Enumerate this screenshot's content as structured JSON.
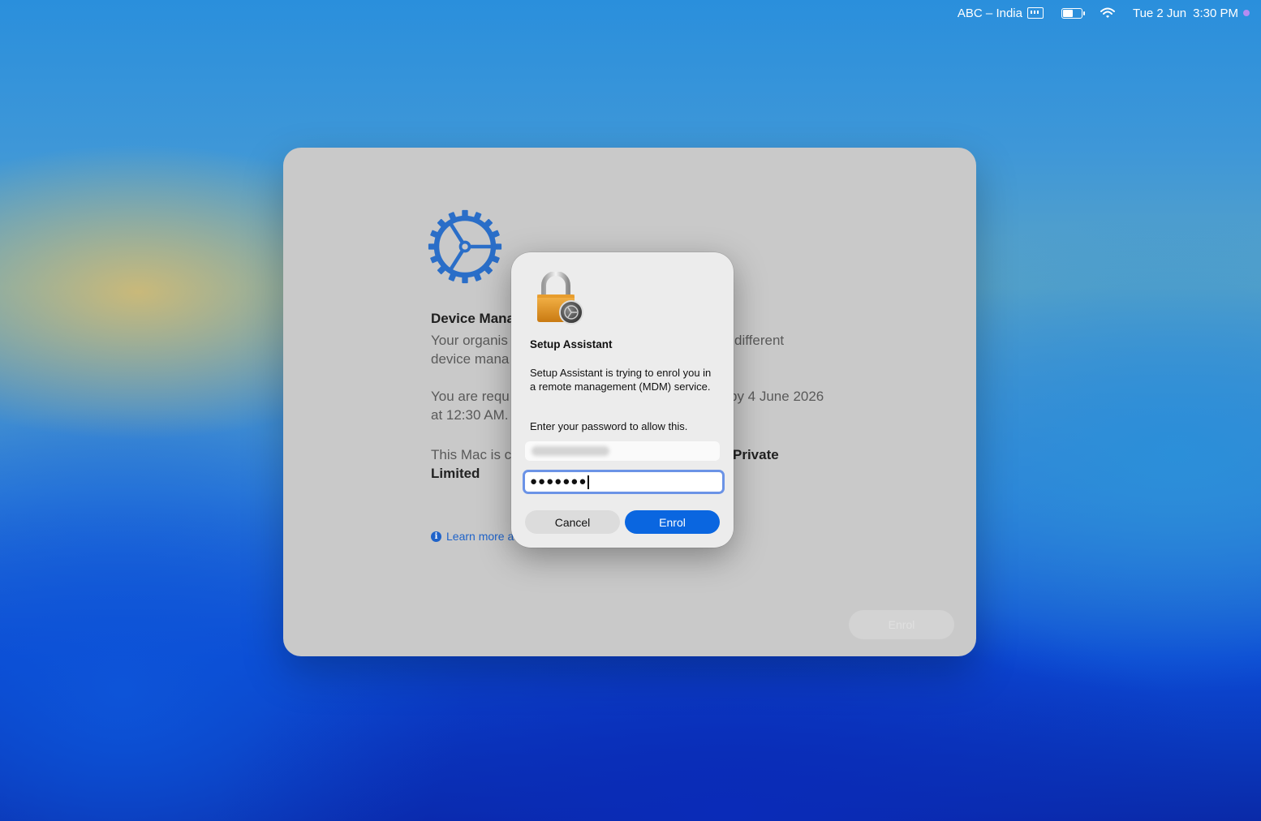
{
  "menubar": {
    "input_source": "ABC – India",
    "date": "Tue 2 Jun",
    "time": "3:30 PM",
    "icons": [
      "keyboard-icon",
      "battery-icon",
      "wifi-icon",
      "siri-dot-icon"
    ]
  },
  "window": {
    "title_partial": "Device Mana",
    "para1_line1_partial": "Your organis",
    "para1_line2_partial": "device mana",
    "para1_right_partial": "different",
    "para2_line1_partial": "You are requ",
    "para2_line2_partial": "at 12:30 AM.",
    "para2_right_partial": "by 4 June 2026",
    "para3_line1_partial": "This Mac is c",
    "para3_line2": "Limited",
    "para3_right_partial": "Private",
    "learn_more_partial": "Learn more a",
    "enrol_button": "Enrol",
    "icon": "gear-icon"
  },
  "dialog": {
    "icon": "lock-icon",
    "title": "Setup Assistant",
    "message": "Setup Assistant is trying to enrol you in a remote management (MDM) service.",
    "prompt": "Enter your password to allow this.",
    "password_value": "●●●●●●●",
    "cancel_label": "Cancel",
    "enrol_label": "Enrol"
  },
  "colors": {
    "accent": "#0a66e0",
    "focus_ring": "#6b93e6",
    "gear": "#2a6ec8"
  }
}
